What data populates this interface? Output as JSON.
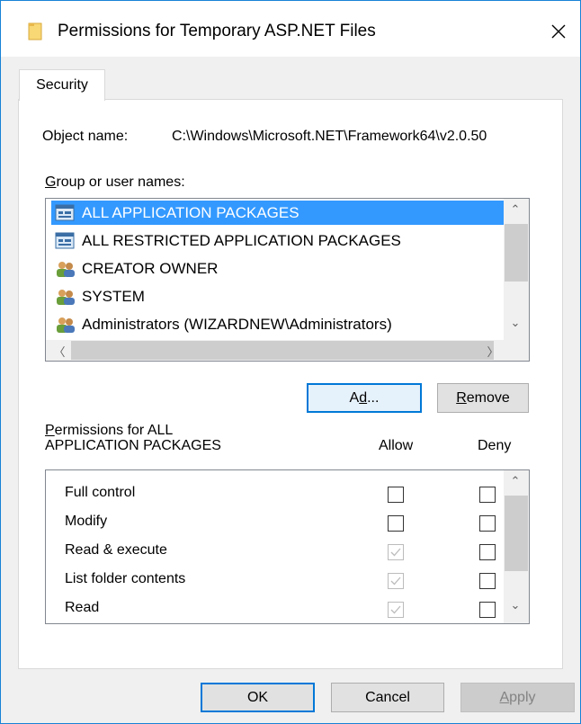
{
  "window": {
    "title": "Permissions for Temporary ASP.NET Files"
  },
  "tabs": [
    {
      "label": "Security"
    }
  ],
  "object": {
    "label": "Object name:",
    "value": "C:\\Windows\\Microsoft.NET\\Framework64\\v2.0.50"
  },
  "groups": {
    "label": "Group or user names:",
    "items": [
      {
        "name": "ALL APPLICATION PACKAGES",
        "icon": "packages-icon",
        "selected": true
      },
      {
        "name": "ALL RESTRICTED APPLICATION PACKAGES",
        "icon": "packages-icon",
        "selected": false
      },
      {
        "name": "CREATOR OWNER",
        "icon": "users-icon",
        "selected": false
      },
      {
        "name": "SYSTEM",
        "icon": "users-icon",
        "selected": false
      },
      {
        "name": "Administrators (WIZARDNEW\\Administrators)",
        "icon": "users-icon",
        "selected": false
      }
    ]
  },
  "buttons": {
    "add": {
      "pre": "A",
      "accel": "d",
      "post": "d..."
    },
    "remove": {
      "pre": "",
      "accel": "R",
      "post": "emove"
    },
    "ok": "OK",
    "cancel": "Cancel",
    "apply": {
      "pre": "",
      "accel": "A",
      "post": "pply"
    }
  },
  "permissions": {
    "header_line1": "Permissions for ALL",
    "header_line2": "APPLICATION PACKAGES",
    "header_accel": "P",
    "allow_label": "Allow",
    "deny_label": "Deny",
    "rows": [
      {
        "name": "Full control",
        "allow": false,
        "allow_disabled": false,
        "deny": false
      },
      {
        "name": "Modify",
        "allow": false,
        "allow_disabled": false,
        "deny": false
      },
      {
        "name": "Read & execute",
        "allow": true,
        "allow_disabled": true,
        "deny": false
      },
      {
        "name": "List folder contents",
        "allow": true,
        "allow_disabled": true,
        "deny": false
      },
      {
        "name": "Read",
        "allow": true,
        "allow_disabled": true,
        "deny": false
      }
    ]
  },
  "colors": {
    "selection": "#3399ff",
    "accent": "#0078d7",
    "folder": "#f8d775"
  }
}
